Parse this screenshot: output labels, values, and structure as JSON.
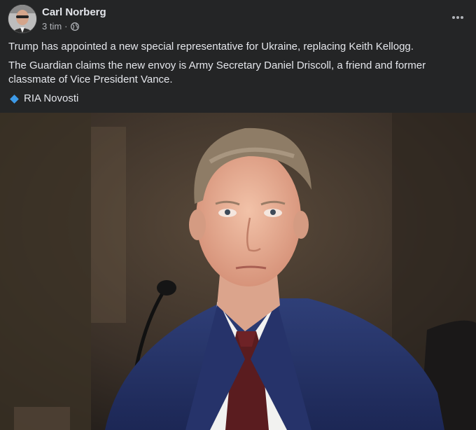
{
  "post": {
    "author": "Carl Norberg",
    "time": "3 tim",
    "separator": "·",
    "privacy_icon": "globe-icon",
    "more_icon": "more-options-icon",
    "paragraphs": [
      "Trump has appointed a new special representative for Ukraine, replacing Keith Kellogg.",
      "The Guardian claims the new envoy is Army Secretary Daniel Driscoll, a friend and former classmate of Vice President Vance."
    ],
    "source_label": "RIA Novosti",
    "source_icon": "blue-diamond-icon"
  },
  "colors": {
    "background": "#242526",
    "primary_text": "#e4e6eb",
    "secondary_text": "#b0b3b8",
    "diamond": "#3d9ae8"
  }
}
